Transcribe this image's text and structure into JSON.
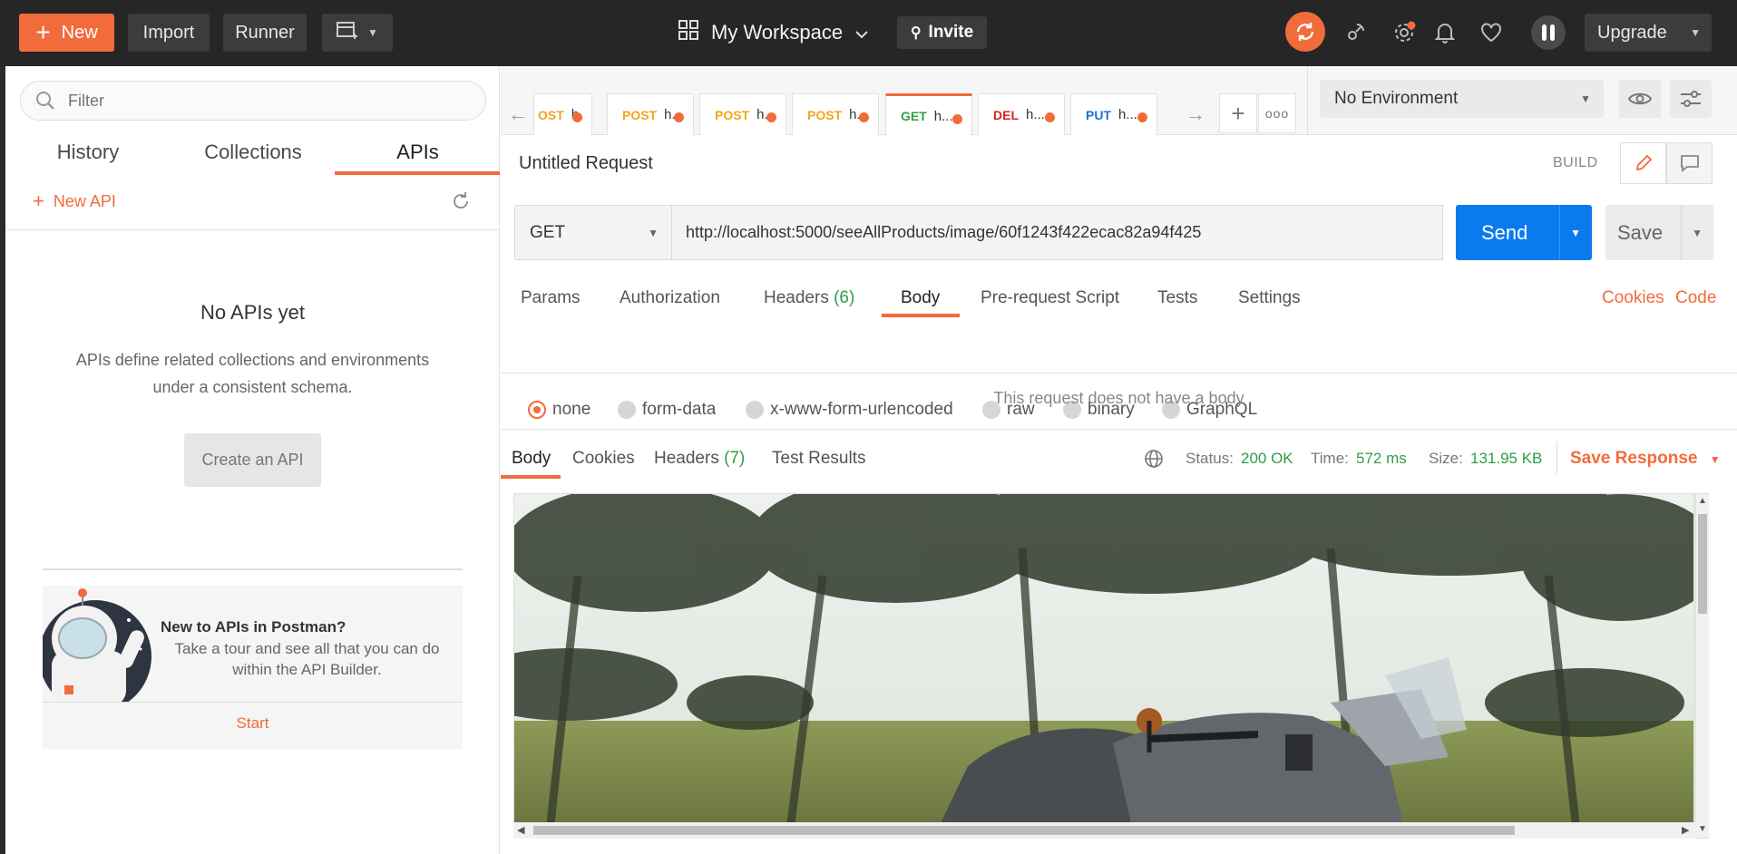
{
  "header": {
    "new_label": "New",
    "import_label": "Import",
    "runner_label": "Runner",
    "workspace_label": "My Workspace",
    "invite_label": "Invite",
    "upgrade_label": "Upgrade"
  },
  "sidebar": {
    "filter_placeholder": "Filter",
    "tabs": [
      "History",
      "Collections",
      "APIs"
    ],
    "active_tab": "APIs",
    "new_api_label": "New API",
    "empty_title": "No APIs yet",
    "empty_desc_line1": "APIs define related collections and environments",
    "empty_desc_line2": "under a consistent schema.",
    "create_button": "Create an API",
    "promo_title": "New to APIs in Postman?",
    "promo_line1": "Take a tour and see all that you can do",
    "promo_line2": "within the API Builder.",
    "promo_start": "Start"
  },
  "request_tabs": [
    {
      "method": "POST",
      "name": "h.",
      "color": "#f2a51a",
      "partial": "OST"
    },
    {
      "method": "POST",
      "name": "h.",
      "color": "#f2a51a"
    },
    {
      "method": "POST",
      "name": "h.",
      "color": "#f2a51a"
    },
    {
      "method": "POST",
      "name": "h.",
      "color": "#f2a51a"
    },
    {
      "method": "GET",
      "name": "h...",
      "color": "#2f9e47",
      "active": true
    },
    {
      "method": "DEL",
      "name": "h...",
      "color": "#d8261c"
    },
    {
      "method": "PUT",
      "name": "h...",
      "color": "#1e6fd9"
    }
  ],
  "environment": {
    "selected": "No Environment"
  },
  "request": {
    "title": "Untitled Request",
    "build_label": "BUILD",
    "method": "GET",
    "url": "http://localhost:5000/seeAllProducts/image/60f1243f422ecac82a94f425",
    "send_label": "Send",
    "save_label": "Save",
    "tabs": {
      "params": "Params",
      "authorization": "Authorization",
      "headers": "Headers",
      "headers_count": "(6)",
      "body": "Body",
      "prerequest": "Pre-request Script",
      "tests": "Tests",
      "settings": "Settings"
    },
    "cookies_link": "Cookies",
    "code_link": "Code",
    "body_types": [
      "none",
      "form-data",
      "x-www-form-urlencoded",
      "raw",
      "binary",
      "GraphQL"
    ],
    "selected_body_type": "none",
    "no_body_msg": "This request does not have a body"
  },
  "response": {
    "tabs": {
      "body": "Body",
      "cookies": "Cookies",
      "headers": "Headers",
      "headers_count": "(7)",
      "test_results": "Test Results"
    },
    "status_label": "Status:",
    "status_value": "200 OK",
    "time_label": "Time:",
    "time_value": "572 ms",
    "size_label": "Size:",
    "size_value": "131.95 KB",
    "save_response_label": "Save Response"
  },
  "colors": {
    "accent": "#f26b3a",
    "send_blue": "#097bed",
    "status_green": "#2f9e47"
  }
}
